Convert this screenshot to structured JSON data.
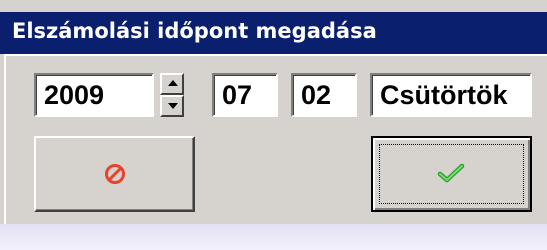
{
  "window": {
    "title": "Elszámolási időpont megadása"
  },
  "date": {
    "year": "2009",
    "month": "07",
    "day": "02",
    "weekday": "Csütörtök"
  },
  "buttons": {
    "cancel_icon": "cancel-icon",
    "ok_icon": "checkmark-icon"
  },
  "colors": {
    "titlebar": "#0a1f6e",
    "cancel_icon": "#e8432a",
    "ok_icon": "#3cb83c"
  }
}
